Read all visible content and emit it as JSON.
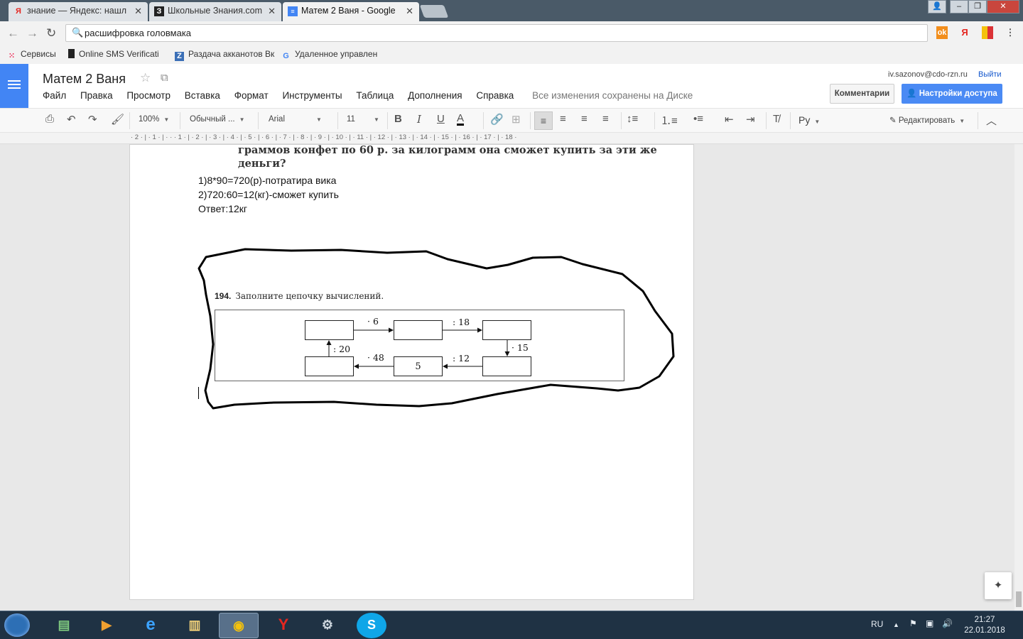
{
  "browser": {
    "tabs": [
      {
        "icon": "yandex-icon",
        "title": "знание — Яндекс: нашл",
        "active": false
      },
      {
        "icon": "znanija-icon",
        "title": "Школьные Знания.com",
        "active": false
      },
      {
        "icon": "docs-icon",
        "title": "Матем 2 Ваня - Google",
        "active": true
      }
    ],
    "omnibox": {
      "text": "расшифровка головмака"
    },
    "extensions": [
      "odnoklassniki-icon",
      "yandex-icon",
      "bookmark-flag-icon",
      "menu-dots-icon"
    ],
    "bookmarks": [
      {
        "icon": "apps-icon",
        "label": "Сервисы"
      },
      {
        "icon": "phone-icon",
        "label": "Online SMS Verificati"
      },
      {
        "icon": "z-icon",
        "label": "Раздача акканотов Вк"
      },
      {
        "icon": "google-icon",
        "label": "Удаленное управлен"
      }
    ]
  },
  "docs": {
    "title": "Матем 2 Ваня",
    "menu": [
      "Файл",
      "Правка",
      "Просмотр",
      "Вставка",
      "Формат",
      "Инструменты",
      "Таблица",
      "Дополнения",
      "Справка"
    ],
    "save_status": "Все изменения сохранены на Диске",
    "user_email": "iv.sazonov@cdo-rzn.ru",
    "logout": "Выйти",
    "comments_button": "Комментарии",
    "share_button": "Настройки доступа",
    "toolbar": {
      "zoom": "100%",
      "style": "Обычный ...",
      "font": "Arial",
      "size": "11",
      "language": "Ру",
      "mode": "Редактировать"
    },
    "ruler": "· 2 · | · 1 · | · · · 1 · | · 2 · | · 3 · | · 4 · | · 5 · | · 6 · | · 7 · | · 8 · | · 9 · | · 10 · | · 11 · | · 12 · | · 13 · | · 14 · | · 15 · | · 16 · | · 17 · | · 18 ·"
  },
  "document": {
    "scan_lines": [
      "граммов конфет по 60 р. за килограмм она сможет купить за эти же",
      "деньги?"
    ],
    "answer_lines": [
      "1)8*90=720(р)-потратира вика",
      "2)720:60=12(кг)-сможет купить",
      "Ответ:12кг"
    ],
    "exercise": {
      "number": "194.",
      "title": "Заполните цепочку вычислений.",
      "box_values": [
        "",
        "",
        "",
        "",
        "5",
        ""
      ],
      "operations": [
        "· 6",
        ": 18",
        "· 15",
        ": 12",
        "· 48",
        ": 20"
      ]
    }
  },
  "taskbar": {
    "apps": [
      "task-manager-icon",
      "media-player-icon",
      "internet-explorer-icon",
      "file-explorer-icon",
      "chrome-icon",
      "yandex-browser-icon",
      "steam-icon",
      "skype-icon"
    ],
    "language": "RU",
    "time": "21:27",
    "date": "22.01.2018"
  }
}
